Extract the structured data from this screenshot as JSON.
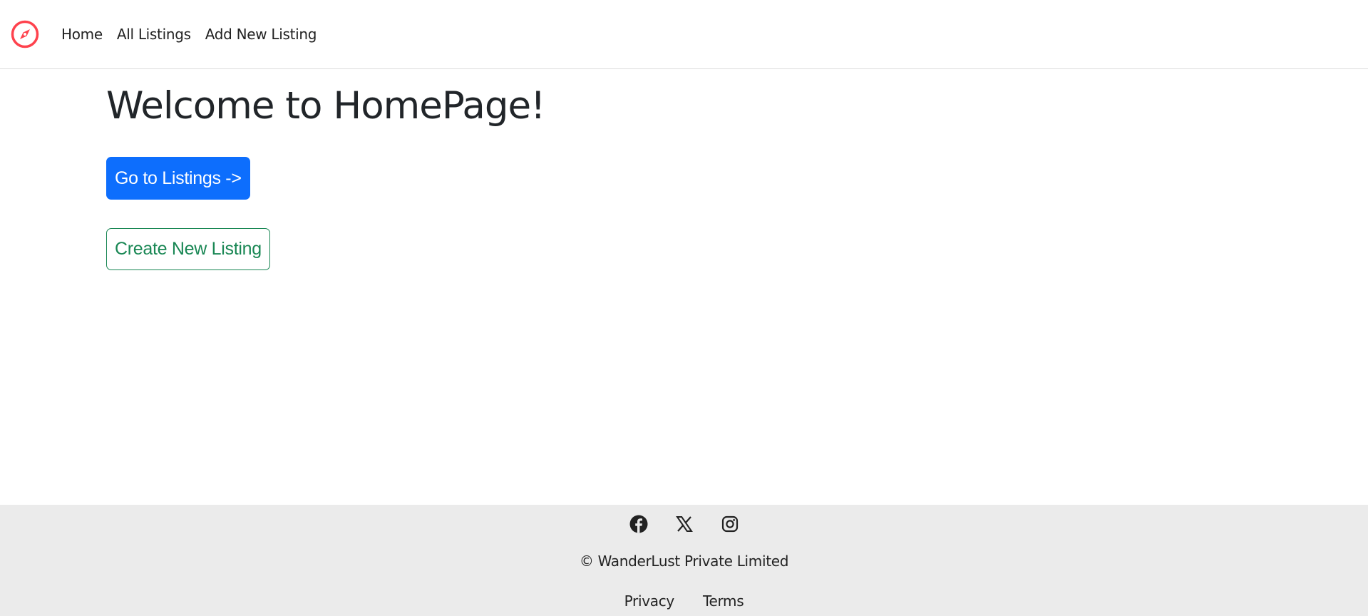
{
  "navbar": {
    "brand_icon": "compass-icon",
    "brand_color": "#fe424d",
    "links": [
      {
        "label": "Home"
      },
      {
        "label": "All Listings"
      },
      {
        "label": "Add New Listing"
      }
    ]
  },
  "main": {
    "title": "Welcome to HomePage!",
    "primary_button": "Go to Listings ->",
    "secondary_button": "Create New Listing"
  },
  "footer": {
    "socials": [
      "facebook-icon",
      "x-icon",
      "instagram-icon"
    ],
    "copyright": "© WanderLust Private Limited",
    "links": [
      {
        "label": "Privacy"
      },
      {
        "label": "Terms"
      }
    ],
    "background": "#ebebeb"
  },
  "colors": {
    "primary": "#0d6efd",
    "success": "#198754",
    "text": "#222222"
  }
}
